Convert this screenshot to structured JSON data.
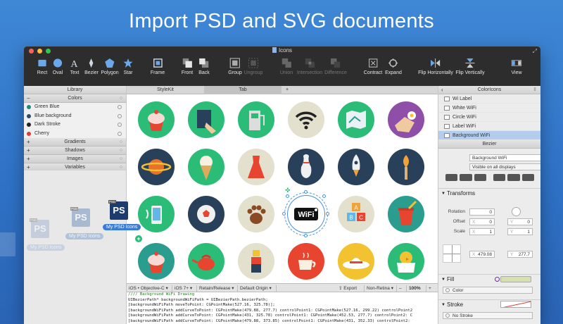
{
  "headline": "Import PSD and SVG documents",
  "window": {
    "title": "Icons",
    "traffic_light_colors": [
      "#fc605b",
      "#fdbc40",
      "#34c84a"
    ]
  },
  "toolbar": [
    {
      "label": "Rect",
      "icon": "rect-icon"
    },
    {
      "label": "Oval",
      "icon": "oval-icon"
    },
    {
      "label": "Text",
      "icon": "text-icon"
    },
    {
      "label": "Bezier",
      "icon": "bezier-icon"
    },
    {
      "label": "Polygon",
      "icon": "polygon-icon"
    },
    {
      "label": "Star",
      "icon": "star-icon"
    },
    {
      "label": "Frame",
      "icon": "frame-icon"
    },
    {
      "label": "Front",
      "icon": "bring-front-icon"
    },
    {
      "label": "Back",
      "icon": "send-back-icon"
    },
    {
      "label": "Group",
      "icon": "group-icon"
    },
    {
      "label": "Ungroup",
      "icon": "ungroup-icon"
    },
    {
      "label": "Union",
      "icon": "union-icon"
    },
    {
      "label": "Intersection",
      "icon": "intersection-icon"
    },
    {
      "label": "Difference",
      "icon": "difference-icon"
    },
    {
      "label": "Contract",
      "icon": "contract-icon"
    },
    {
      "label": "Expand",
      "icon": "expand-icon"
    },
    {
      "label": "Flip Horizontally",
      "icon": "flip-horizontal-icon"
    },
    {
      "label": "Flip Vertically",
      "icon": "flip-vertical-icon"
    },
    {
      "label": "View",
      "icon": "view-icon"
    }
  ],
  "library": {
    "title": "Library",
    "colors_title": "Colors",
    "colors": [
      {
        "name": "Green Blue",
        "swatch": "#1f8a7a"
      },
      {
        "name": "Blue background",
        "swatch": "#2b4d6b"
      },
      {
        "name": "Dark Stroke",
        "swatch": "#222222"
      },
      {
        "name": "Cherry",
        "swatch": "#e03c31"
      }
    ],
    "sections": [
      "Gradients",
      "Shadows",
      "Images",
      "Variables"
    ]
  },
  "tabs": {
    "stylekit": "StyleKit",
    "tab": "Tab",
    "add": "+"
  },
  "canvas_icons": [
    [
      "cupcake-icon",
      "hand-book-icon",
      "gas-pump-icon",
      "wifi-icon",
      "map-icon",
      "hand-flower-icon"
    ],
    [
      "planet-icon",
      "ice-cream-icon",
      "dress-icon",
      "bowling-icon",
      "rocket-icon",
      "torch-icon"
    ],
    [
      "phone-wifi-icon",
      "soccer-ball-icon",
      "paw-icon",
      "wifi-label-icon",
      "abc-blocks-icon",
      "paint-bucket-icon"
    ],
    [
      "muffin-icon",
      "teapot-icon",
      "lego-figure-icon",
      "coffee-cup-icon",
      "sun-hat-icon",
      "chick-icon"
    ]
  ],
  "canvas_colors": [
    [
      "#2bbd78",
      "#2bbd78",
      "#2bbd78",
      "#e3e0ce",
      "#2bbd78",
      "#8f4fa8"
    ],
    [
      "#29405b",
      "#2bbd78",
      "#e3e0ce",
      "#29405b",
      "#29405b",
      "#29405b"
    ],
    [
      "#2bbd78",
      "#29405b",
      "#e3e0ce",
      "#ffffff",
      "#e3e0ce",
      "#2a9d8f"
    ],
    [
      "#2a9d8f",
      "#2bbd78",
      "#e3e0ce",
      "#e7452f",
      "#f2c230",
      "#2bbd78"
    ]
  ],
  "wifi_label_text": "WiFi",
  "code_bar": {
    "language": "iOS • Objective-C",
    "platform": "iOS 7+",
    "memory": "Retain/Release",
    "origin": "Default Origin",
    "export": "Export",
    "retina": "Non-Retina",
    "zoom": "100%",
    "minus": "–",
    "plus": "+"
  },
  "code_lines": [
    "//// Background WiFi Drawing",
    "UIBezierPath* backgroundWiFiPath = UIBezierPath.bezierPath;",
    "[backgroundWiFiPath moveToPoint: CGPointMake(527.16, 325.78)];",
    "[backgroundWiFiPath addCurveToPoint: CGPointMake(479.88, 277.7) controlPoint1: CGPointMake(527.16, 299.22) controlPoint2",
    "[backgroundWiFiPath addCurveToPoint: CGPointMake(431, 325.78) controlPoint1: CGPointMake(452.53, 277.7) controlPoint2: C",
    "[backgroundWiFiPath addCurveToPoint: CGPointMake(479.88, 373.85) controlPoint1: CGPointMake(431, 352.33) controlPoint2:"
  ],
  "layers": {
    "title": "ColorIcons",
    "items": [
      "Wi Label",
      "White WiFi",
      "Circle WiFi",
      "Label WiFi",
      "Background WiFi"
    ],
    "selected_index": 4
  },
  "inspector": {
    "section": "Bezier",
    "name_value": "Background WiFi",
    "visibility": "Visible on all displays",
    "transforms_title": "Transforms",
    "rotation_label": "Rotation",
    "rotation_value": "0",
    "offset_label": "Offset",
    "offset_x_label": "X",
    "offset_x": "0",
    "offset_y_label": "Y",
    "offset_y": "0",
    "scale_label": "Scale",
    "scale_x_label": "X",
    "scale_x": "1",
    "scale_y_label": "Y",
    "scale_y": "1",
    "pos_x_label": "X",
    "pos_x": "479.08",
    "pos_y_label": "Y",
    "pos_y": "277.7",
    "fill_title": "Fill",
    "fill_type": "Color",
    "fill_color": "#d6dfae",
    "stroke_title": "Stroke",
    "stroke_type": "No Stroke"
  },
  "drag_items": [
    {
      "label": "My PSD Icons",
      "opacity": 0.35
    },
    {
      "label": "My PSD Icons",
      "opacity": 0.6
    },
    {
      "label": "My PSD Icons",
      "opacity": 1
    }
  ],
  "psd_badge": "PS",
  "psd_tag": "PSD"
}
